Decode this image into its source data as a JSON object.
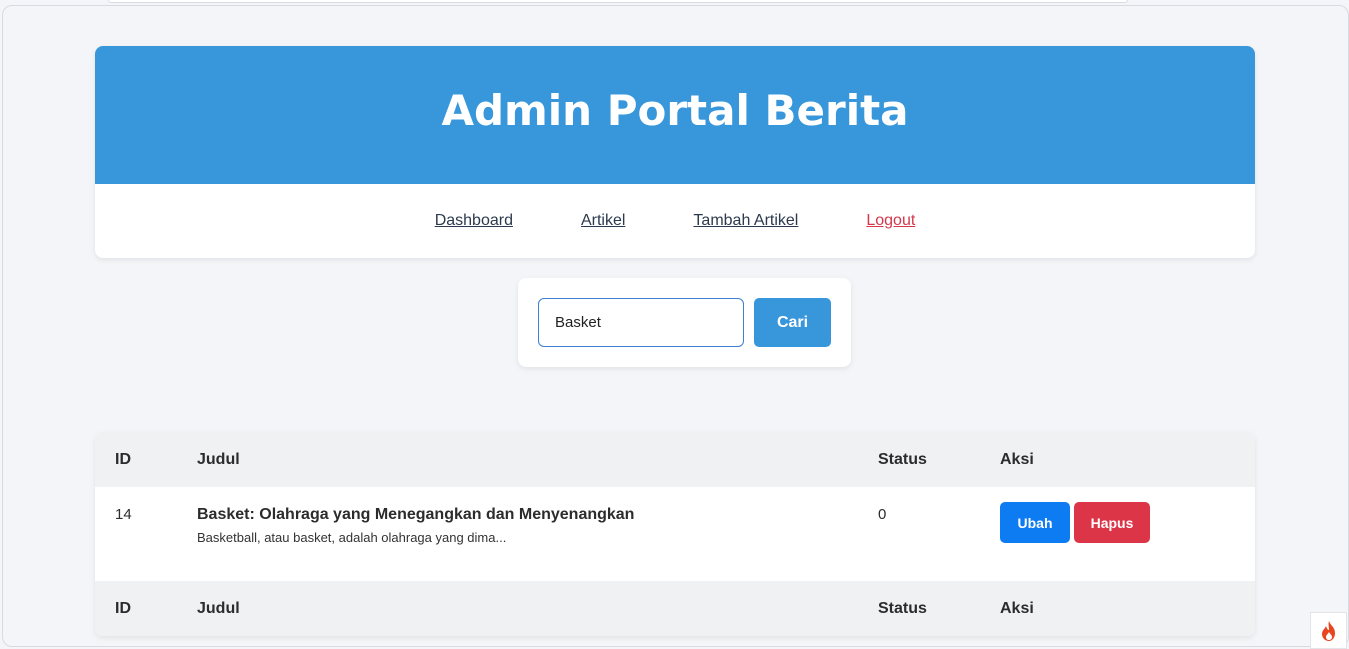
{
  "header": {
    "title": "Admin Portal Berita"
  },
  "nav": {
    "items": [
      {
        "label": "Dashboard"
      },
      {
        "label": "Artikel"
      },
      {
        "label": "Tambah Artikel"
      },
      {
        "label": "Logout"
      }
    ]
  },
  "search": {
    "value": "Basket",
    "button_label": "Cari"
  },
  "table": {
    "columns": [
      "ID",
      "Judul",
      "Status",
      "Aksi"
    ],
    "rows": [
      {
        "id": "14",
        "title": "Basket: Olahraga yang Menegangkan dan Menyenangkan",
        "excerpt": "Basketball, atau basket, adalah olahraga yang dima...",
        "status": "0",
        "edit_label": "Ubah",
        "delete_label": "Hapus"
      }
    ],
    "footer_columns": [
      "ID",
      "Judul",
      "Status",
      "Aksi"
    ]
  },
  "colors": {
    "primary": "#3897db",
    "edit_button": "#0d7bf2",
    "delete_button": "#dc3548",
    "logout_link": "#d3384a"
  },
  "icons": {
    "framework_badge": "flame-icon"
  }
}
